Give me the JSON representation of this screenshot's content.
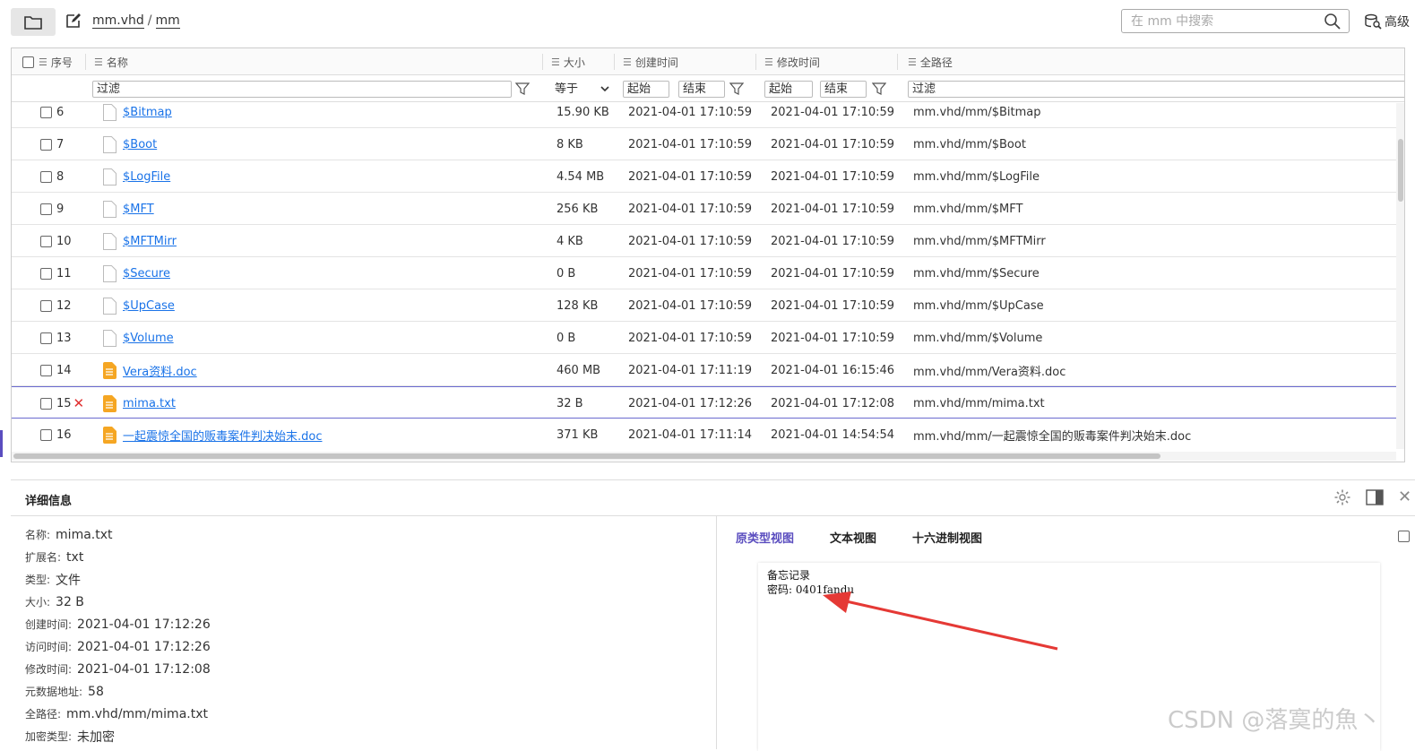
{
  "toolbar": {
    "breadcrumb": [
      "mm.vhd",
      "mm"
    ],
    "separator": "/",
    "search_placeholder": "在 mm 中搜索",
    "advanced_label": "高级"
  },
  "table": {
    "headers": {
      "index": "序号",
      "name": "名称",
      "size": "大小",
      "created": "创建时间",
      "modified": "修改时间",
      "path": "全路径"
    },
    "filters": {
      "name": "过滤",
      "size_op": "等于",
      "created_start": "起始",
      "created_end": "结束",
      "modified_start": "起始",
      "modified_end": "结束",
      "path": "过滤"
    },
    "rows": [
      {
        "idx": "6",
        "name": "$Bitmap",
        "size": "15.90 KB",
        "created": "2021-04-01 17:10:59",
        "modified": "2021-04-01 17:10:59",
        "path": "mm.vhd/mm/$Bitmap",
        "icon": "blank-file-icon"
      },
      {
        "idx": "7",
        "name": "$Boot",
        "size": "8 KB",
        "created": "2021-04-01 17:10:59",
        "modified": "2021-04-01 17:10:59",
        "path": "mm.vhd/mm/$Boot",
        "icon": "blank-file-icon"
      },
      {
        "idx": "8",
        "name": "$LogFile",
        "size": "4.54 MB",
        "created": "2021-04-01 17:10:59",
        "modified": "2021-04-01 17:10:59",
        "path": "mm.vhd/mm/$LogFile",
        "icon": "blank-file-icon"
      },
      {
        "idx": "9",
        "name": "$MFT",
        "size": "256 KB",
        "created": "2021-04-01 17:10:59",
        "modified": "2021-04-01 17:10:59",
        "path": "mm.vhd/mm/$MFT",
        "icon": "blank-file-icon"
      },
      {
        "idx": "10",
        "name": "$MFTMirr",
        "size": "4 KB",
        "created": "2021-04-01 17:10:59",
        "modified": "2021-04-01 17:10:59",
        "path": "mm.vhd/mm/$MFTMirr",
        "icon": "blank-file-icon"
      },
      {
        "idx": "11",
        "name": "$Secure",
        "size": "0 B",
        "created": "2021-04-01 17:10:59",
        "modified": "2021-04-01 17:10:59",
        "path": "mm.vhd/mm/$Secure",
        "icon": "blank-file-icon"
      },
      {
        "idx": "12",
        "name": "$UpCase",
        "size": "128 KB",
        "created": "2021-04-01 17:10:59",
        "modified": "2021-04-01 17:10:59",
        "path": "mm.vhd/mm/$UpCase",
        "icon": "blank-file-icon"
      },
      {
        "idx": "13",
        "name": "$Volume",
        "size": "0 B",
        "created": "2021-04-01 17:10:59",
        "modified": "2021-04-01 17:10:59",
        "path": "mm.vhd/mm/$Volume",
        "icon": "blank-file-icon"
      },
      {
        "idx": "14",
        "name": "Vera资料.doc",
        "size": "460 MB",
        "created": "2021-04-01 17:11:19",
        "modified": "2021-04-01 16:15:46",
        "path": "mm.vhd/mm/Vera资料.doc",
        "icon": "document-file-icon"
      },
      {
        "idx": "15",
        "name": "mima.txt",
        "size": "32 B",
        "created": "2021-04-01 17:12:26",
        "modified": "2021-04-01 17:12:08",
        "path": "mm.vhd/mm/mima.txt",
        "icon": "document-file-icon",
        "selected": true,
        "mark": "✕"
      },
      {
        "idx": "16",
        "name": "一起震惊全国的贩毒案件判决始末.doc",
        "size": "371 KB",
        "created": "2021-04-01 17:11:14",
        "modified": "2021-04-01 14:54:54",
        "path": "mm.vhd/mm/一起震惊全国的贩毒案件判决始末.doc",
        "icon": "document-file-icon"
      }
    ]
  },
  "detail": {
    "title": "详细信息",
    "props": [
      {
        "k": "名称:",
        "v": "mima.txt"
      },
      {
        "k": "扩展名:",
        "v": "txt"
      },
      {
        "k": "类型:",
        "v": "文件"
      },
      {
        "k": "大小:",
        "v": "32 B"
      },
      {
        "k": "创建时间:",
        "v": "2021-04-01 17:12:26"
      },
      {
        "k": "访问时间:",
        "v": "2021-04-01 17:12:26"
      },
      {
        "k": "修改时间:",
        "v": "2021-04-01 17:12:08"
      },
      {
        "k": "元数据地址:",
        "v": "58"
      },
      {
        "k": "全路径:",
        "v": "mm.vhd/mm/mima.txt"
      },
      {
        "k": "加密类型:",
        "v": "未加密"
      }
    ],
    "view_tabs": [
      "原类型视图",
      "文本视图",
      "十六进制视图"
    ],
    "preview_lines": [
      "备忘记录",
      "密码: 0401fandu"
    ]
  },
  "watermark": "CSDN @落寞的魚丶",
  "colors": {
    "accent": "#5a4dbf",
    "link": "#1a73e8",
    "file_icon": "#f5a623",
    "mark": "#e03030",
    "arrow": "#e53935"
  }
}
